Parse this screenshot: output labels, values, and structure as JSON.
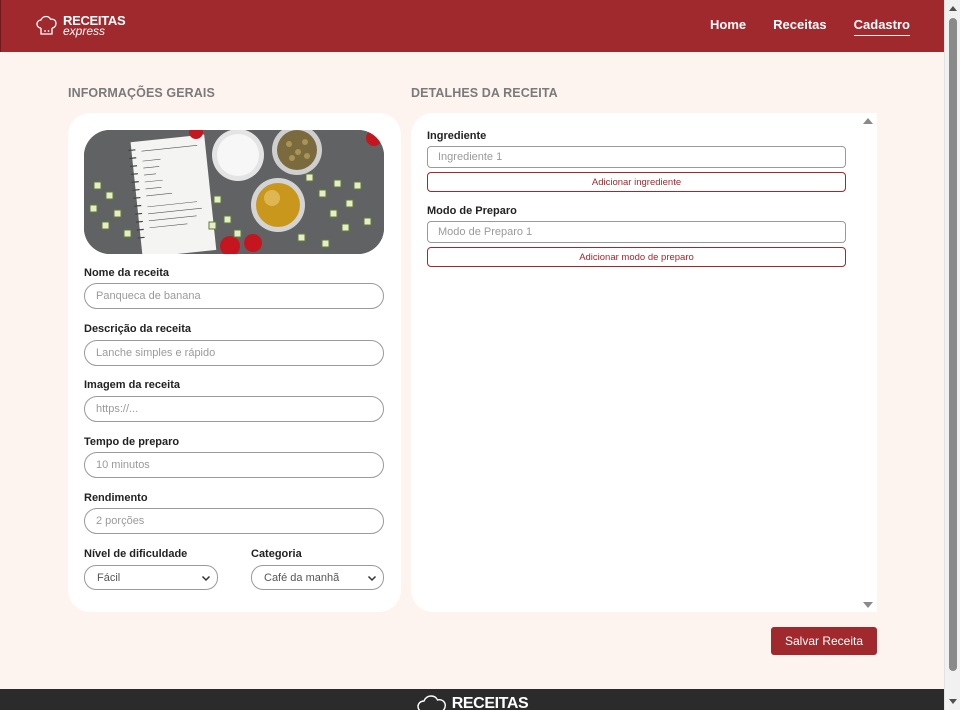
{
  "header": {
    "logo_main": "RECEITAS",
    "logo_sub": "express",
    "nav": [
      {
        "label": "Home"
      },
      {
        "label": "Receitas"
      },
      {
        "label": "Cadastro",
        "active": true
      }
    ]
  },
  "sections": {
    "left_title": "INFORMAÇÕES GERAIS",
    "right_title": "DETALHES DA RECEITA"
  },
  "form": {
    "nome": {
      "label": "Nome da receita",
      "placeholder": "Panqueca de banana",
      "value": ""
    },
    "descricao": {
      "label": "Descrição da receita",
      "placeholder": "Lanche simples e rápido",
      "value": ""
    },
    "imagem": {
      "label": "Imagem da receita",
      "placeholder": "https://...",
      "value": ""
    },
    "tempo": {
      "label": "Tempo de preparo",
      "placeholder": "10 minutos",
      "value": ""
    },
    "rendimento": {
      "label": "Rendimento",
      "placeholder": "2 porções",
      "value": ""
    },
    "dificuldade": {
      "label": "Nível de dificuldade",
      "selected": "Fácil"
    },
    "categoria": {
      "label": "Categoria",
      "selected": "Café da manhã"
    }
  },
  "details": {
    "ingrediente": {
      "label": "Ingrediente",
      "placeholder": "Ingrediente 1",
      "add_label": "Adicionar ingrediente"
    },
    "preparo": {
      "label": "Modo de Preparo",
      "placeholder": "Modo de Preparo 1",
      "add_label": "Adicionar modo de preparo"
    }
  },
  "actions": {
    "save_label": "Salvar Receita"
  },
  "footer": {
    "logo_main": "RECEITAS"
  },
  "colors": {
    "brand": "#a0292d",
    "page_bg": "#fdf4f0",
    "footer_bg": "#2b2b2b"
  }
}
